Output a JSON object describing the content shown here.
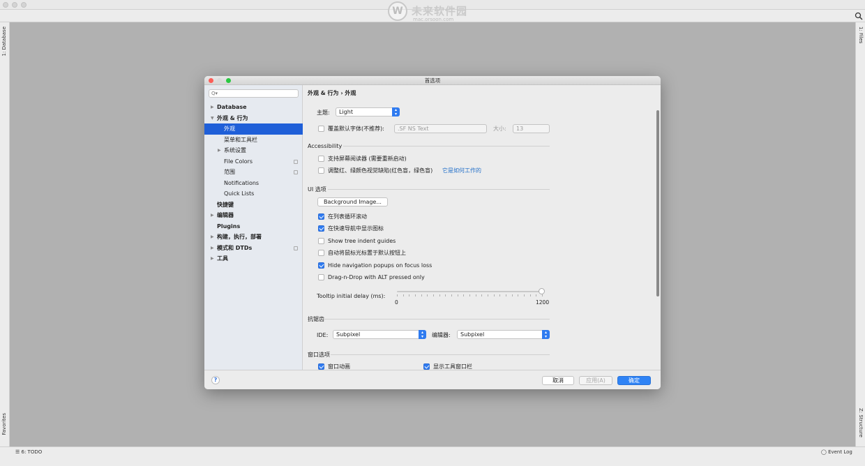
{
  "watermark": {
    "logo_mark": "W",
    "title": "未来软件园",
    "subtitle": "mac.orsoon.com"
  },
  "ide": {
    "left_tool_top": "1: Database",
    "left_tool_bottom": "Favorites",
    "right_tool_top": "1: Files",
    "right_tool_bottom": "Z: Structure",
    "status_todo": "6: TODO",
    "status_event_log": "Event Log"
  },
  "dialog": {
    "title": "首选项",
    "search_placeholder": "Q▾",
    "breadcrumb": "外观 & 行为  ›  外观",
    "tree": [
      {
        "label": "Database",
        "arrow": "▶",
        "level": 0,
        "bold": true
      },
      {
        "label": "外观 & 行为",
        "arrow": "▼",
        "level": 0,
        "bold": true
      },
      {
        "label": "外观",
        "arrow": "",
        "level": 1,
        "selected": true
      },
      {
        "label": "菜单和工具栏",
        "arrow": "",
        "level": 1
      },
      {
        "label": "系统设置",
        "arrow": "▶",
        "level": 1
      },
      {
        "label": "File Colors",
        "arrow": "",
        "level": 1,
        "copy": true
      },
      {
        "label": "范围",
        "arrow": "",
        "level": 1,
        "copy": true
      },
      {
        "label": "Notifications",
        "arrow": "",
        "level": 1
      },
      {
        "label": "Quick Lists",
        "arrow": "",
        "level": 1
      },
      {
        "label": "快捷键",
        "arrow": "",
        "level": 0,
        "bold": true
      },
      {
        "label": "编辑器",
        "arrow": "▶",
        "level": 0,
        "bold": true
      },
      {
        "label": "Plugins",
        "arrow": "",
        "level": 0,
        "bold": true
      },
      {
        "label": "构建，执行，部署",
        "arrow": "▶",
        "level": 0,
        "bold": true
      },
      {
        "label": "模式和 DTDs",
        "arrow": "▶",
        "level": 0,
        "bold": true,
        "copy": true
      },
      {
        "label": "工具",
        "arrow": "▶",
        "level": 0,
        "bold": true
      }
    ],
    "theme": {
      "label": "主题:",
      "value": "Light"
    },
    "override_font": {
      "label": "覆盖默认字体(不推荐):",
      "checked": false,
      "font_value": ".SF NS Text",
      "size_label": "大小:",
      "size_value": "13"
    },
    "accessibility": {
      "header": "Accessibility",
      "screen_reader": {
        "label": "支持屏幕阅读器 (需要重新启动)",
        "checked": false
      },
      "color_deficiency": {
        "label": "调整红、绿颜色视觉缺陷(红色盲，绿色盲)",
        "checked": false,
        "link": "它是如何工作的"
      }
    },
    "ui_options": {
      "header": "UI 选项",
      "background_button": "Background Image...",
      "options": [
        {
          "label": "在列表循环滚动",
          "checked": true
        },
        {
          "label": "在快速导航中显示图标",
          "checked": true
        },
        {
          "label": "Show tree indent guides",
          "checked": false
        },
        {
          "label": "自动将鼠标光标置于默认按钮上",
          "checked": false
        },
        {
          "label": "Hide navigation popups on focus loss",
          "checked": true
        },
        {
          "label": "Drag-n-Drop with ALT pressed only",
          "checked": false
        }
      ],
      "tooltip_label": "Tooltip initial delay (ms):",
      "slider_min": "0",
      "slider_max": "1200",
      "slider_value_fraction": 1.0
    },
    "antialiasing": {
      "header": "抗锯齿",
      "ide_label": "IDE:",
      "ide_value": "Subpixel",
      "editor_label": "编辑器:",
      "editor_value": "Subpixel"
    },
    "window_options": {
      "header": "窗口选项",
      "animation": {
        "label": "窗口动画",
        "checked": true
      },
      "tool_window_bar": {
        "label": "显示工具窗口栏",
        "checked": true
      }
    },
    "footer": {
      "help": "?",
      "cancel": "取消",
      "apply": "应用(A)",
      "ok": "确定"
    }
  },
  "colors": {
    "accent": "#2f7bf0",
    "selection": "#1f5fd8",
    "link": "#2470c9",
    "overlay": "#b1b1b1",
    "close": "#fc5d57",
    "minimize": "#fdbc2e",
    "zoom": "#28c840"
  }
}
